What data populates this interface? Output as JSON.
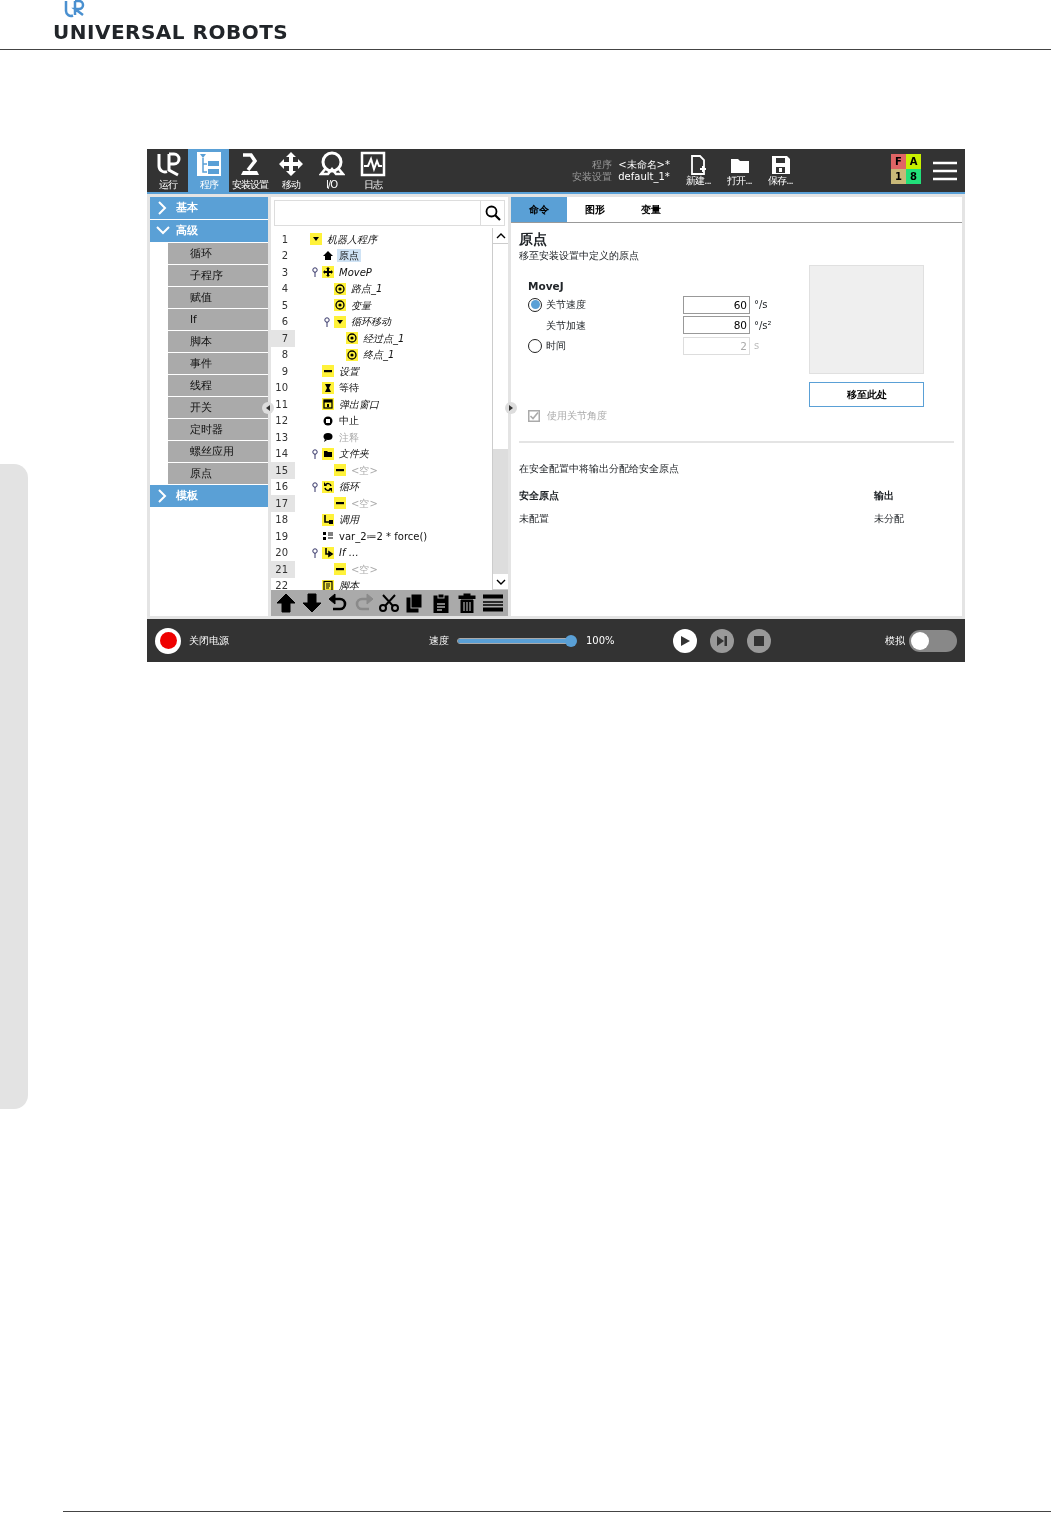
{
  "header": {
    "brand": "UNIVERSAL ROBOTS"
  },
  "top_nav": [
    {
      "label": "运行",
      "selected": false
    },
    {
      "label": "程序",
      "selected": true
    },
    {
      "label": "安装设置",
      "selected": false
    },
    {
      "label": "移动",
      "selected": false
    },
    {
      "label": "I/O",
      "selected": false
    },
    {
      "label": "日志",
      "selected": false
    }
  ],
  "file_info": [
    {
      "label": "程序",
      "value": "<未命名>*"
    },
    {
      "label": "安装设置",
      "value": "default_1*"
    }
  ],
  "file_buttons": [
    "新建...",
    "打开...",
    "保存..."
  ],
  "status": [
    {
      "text": "F",
      "color": "#e06464"
    },
    {
      "text": "A",
      "color": "#c8f000"
    },
    {
      "text": "1",
      "color": "#c8b878"
    },
    {
      "text": "8",
      "color": "#22e07a"
    }
  ],
  "sidebar": [
    {
      "label": "基本",
      "expanded": false
    },
    {
      "label": "高级",
      "expanded": true,
      "children": [
        "循环",
        "子程序",
        "赋值",
        "If",
        "脚本",
        "事件",
        "线程",
        "开关",
        "定时器",
        "螺丝应用",
        "原点"
      ]
    },
    {
      "label": "模板",
      "expanded": false
    }
  ],
  "tree": [
    {
      "num": "1",
      "label": "机器人程序",
      "kind": "program",
      "italic": true,
      "disabled": false,
      "selected": false,
      "marked": false,
      "children": [
        {
          "num": "2",
          "label": "原点",
          "kind": "home",
          "italic": false,
          "disabled": false,
          "selected": true,
          "marked": false
        },
        {
          "num": "3",
          "label": "MoveP",
          "kind": "movep",
          "italic": true,
          "disabled": false,
          "selected": false,
          "marked": false,
          "expanded": true,
          "children": [
            {
              "num": "4",
              "label": "路点_1",
              "kind": "waypoint",
              "italic": true,
              "disabled": false,
              "selected": false,
              "marked": false
            },
            {
              "num": "5",
              "label": "变量",
              "kind": "waypoint",
              "italic": true,
              "disabled": false,
              "selected": false,
              "marked": false
            },
            {
              "num": "6",
              "label": "循环移动",
              "kind": "program",
              "italic": true,
              "disabled": false,
              "selected": false,
              "marked": false,
              "expanded": true,
              "children": [
                {
                  "num": "7",
                  "label": "经过点_1",
                  "kind": "waypoint",
                  "italic": true,
                  "disabled": false,
                  "selected": false,
                  "marked": true
                },
                {
                  "num": "8",
                  "label": "终点_1",
                  "kind": "waypoint",
                  "italic": true,
                  "disabled": false,
                  "selected": false,
                  "marked": false
                }
              ]
            }
          ]
        },
        {
          "num": "9",
          "label": "设置",
          "kind": "set",
          "italic": true,
          "disabled": false,
          "selected": false,
          "marked": false
        },
        {
          "num": "10",
          "label": "等待",
          "kind": "wait",
          "italic": false,
          "disabled": false,
          "selected": false,
          "marked": false
        },
        {
          "num": "11",
          "label": "弹出窗口",
          "kind": "popup",
          "italic": true,
          "disabled": false,
          "selected": false,
          "marked": false
        },
        {
          "num": "12",
          "label": "中止",
          "kind": "halt",
          "italic": false,
          "disabled": false,
          "selected": false,
          "marked": false
        },
        {
          "num": "13",
          "label": "注释",
          "kind": "comment",
          "italic": false,
          "disabled": true,
          "selected": false,
          "marked": false
        },
        {
          "num": "14",
          "label": "文件夹",
          "kind": "folder",
          "italic": true,
          "disabled": false,
          "selected": false,
          "marked": false,
          "expanded": true,
          "children": [
            {
              "num": "15",
              "label": "<空>",
              "kind": "set",
              "italic": false,
              "disabled": true,
              "selected": false,
              "marked": true
            }
          ]
        },
        {
          "num": "16",
          "label": "循环",
          "kind": "loop",
          "italic": true,
          "disabled": false,
          "selected": false,
          "marked": false,
          "expanded": true,
          "children": [
            {
              "num": "17",
              "label": "<空>",
              "kind": "set",
              "italic": false,
              "disabled": true,
              "selected": false,
              "marked": true
            }
          ]
        },
        {
          "num": "18",
          "label": "调用",
          "kind": "call",
          "italic": true,
          "disabled": false,
          "selected": false,
          "marked": false
        },
        {
          "num": "19",
          "label": "var_2≔2 * force()",
          "kind": "assign",
          "italic": false,
          "disabled": false,
          "selected": false,
          "marked": false
        },
        {
          "num": "20",
          "label": "If …",
          "kind": "if",
          "italic": true,
          "disabled": false,
          "selected": false,
          "marked": false,
          "expanded": true,
          "children": [
            {
              "num": "21",
              "label": "<空>",
              "kind": "set",
              "italic": false,
              "disabled": true,
              "selected": false,
              "marked": true
            }
          ]
        },
        {
          "num": "22",
          "label": "脚本",
          "kind": "script",
          "italic": true,
          "disabled": false,
          "selected": false,
          "marked": false
        }
      ]
    }
  ],
  "tree_toolbar": [
    {
      "kind": "up",
      "disabled": false
    },
    {
      "kind": "down",
      "disabled": false
    },
    {
      "kind": "undo",
      "disabled": false
    },
    {
      "kind": "redo",
      "disabled": true
    },
    {
      "kind": "cut",
      "disabled": false
    },
    {
      "kind": "copy",
      "disabled": false
    },
    {
      "kind": "paste",
      "disabled": false
    },
    {
      "kind": "delete",
      "disabled": false
    },
    {
      "kind": "suppress",
      "disabled": false
    }
  ],
  "tabs": [
    {
      "label": "命令",
      "selected": true
    },
    {
      "label": "图形",
      "selected": false
    },
    {
      "label": "变量",
      "selected": false
    }
  ],
  "node_title": "原点",
  "node_description": "移至安装设置中定义的原点",
  "move": {
    "title": "MoveJ",
    "options": [
      {
        "kind": "radio",
        "label": "关节速度",
        "selected": true,
        "value": "60",
        "unit": "°/s",
        "disabled": false
      },
      {
        "kind": "plain",
        "label": "关节加速",
        "value": "80",
        "unit": "°/s²",
        "disabled": false
      },
      {
        "kind": "radio",
        "label": "时间",
        "selected": false,
        "value": "2",
        "unit": "s",
        "disabled": true
      }
    ],
    "checkbox": {
      "label": "使用关节角度",
      "checked": true,
      "disabled": true
    },
    "button": "移至此处"
  },
  "safety": {
    "note": "在安全配置中将输出分配给安全原点",
    "columns": [
      "安全原点",
      "输出"
    ],
    "rows": [
      [
        "未配置",
        "未分配"
      ]
    ]
  },
  "footer_bar": {
    "power": "关闭电源",
    "speed_label": "速度",
    "speed": {
      "level": 1,
      "reading": "100%"
    },
    "simulation": {
      "label": "模拟",
      "on": false
    }
  }
}
